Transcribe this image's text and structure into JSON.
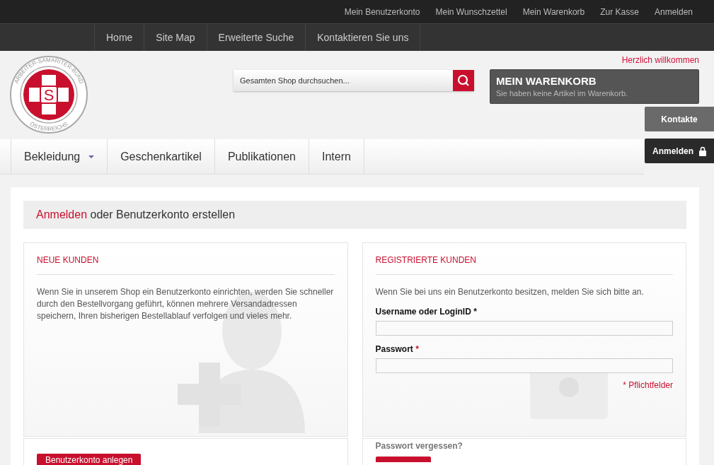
{
  "top_links": [
    "Mein Benutzerkonto",
    "Mein Wunschzettel",
    "Mein Warenkorb",
    "Zur Kasse",
    "Anmelden"
  ],
  "main_nav": [
    "Home",
    "Site Map",
    "Erweiterte Suche",
    "Kontaktieren Sie uns"
  ],
  "logo": {
    "letter": "S",
    "ring_top": "ARBEITER-SAMARITER-BUND",
    "ring_bottom": "ÖSTERREICHS"
  },
  "welcome": "Herzlich willkommen",
  "search": {
    "placeholder": "Gesamten Shop durchsuchen..."
  },
  "cart": {
    "title": "MEIN WARENKORB",
    "text": "Sie haben keine Artikel im Warenkorb."
  },
  "side_buttons": [
    {
      "label": "Kontakte",
      "kind": "plain"
    },
    {
      "label": "Anmelden",
      "kind": "lock"
    }
  ],
  "categories": [
    {
      "label": "Bekleidung",
      "has_dropdown": true
    },
    {
      "label": "Geschenkartikel",
      "has_dropdown": false
    },
    {
      "label": "Publikationen",
      "has_dropdown": false
    },
    {
      "label": "Intern",
      "has_dropdown": false
    }
  ],
  "page_title": {
    "highlight": "Anmelden",
    "rest": "oder Benutzerkonto erstellen"
  },
  "new_customers": {
    "heading": "NEUE KUNDEN",
    "text": "Wenn Sie in unserem Shop ein Benutzerkonto einrichten, werden Sie schneller durch den Bestellvorgang geführt, können mehrere Versandadressen speichern, Ihren bisherigen Bestellablauf verfolgen und vieles mehr.",
    "button": "Benutzerkonto anlegen"
  },
  "registered_customers": {
    "heading": "REGISTRIERTE KUNDEN",
    "text": "Wenn Sie bei uns ein Benutzerkonto besitzen, melden Sie sich bitte an.",
    "fields": [
      {
        "label": "Username oder LoginID",
        "required_mark": "*",
        "mark_red": false
      },
      {
        "label": "Passwort",
        "required_mark": "*",
        "mark_red": true
      }
    ],
    "required_note": "* Pflichtfelder",
    "forgot": "Passwort vergessen?"
  }
}
